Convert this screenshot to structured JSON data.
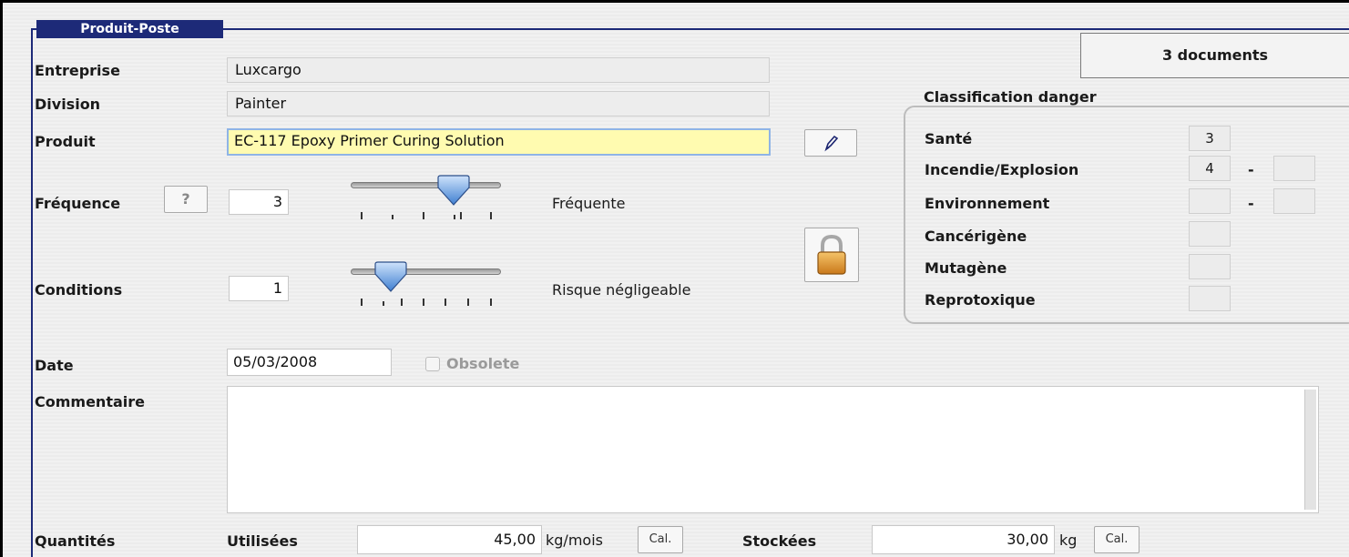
{
  "group": {
    "title": "Produit-Poste"
  },
  "documents_button": "3 documents",
  "fields": {
    "entreprise": {
      "label": "Entreprise",
      "value": "Luxcargo"
    },
    "division": {
      "label": "Division",
      "value": "Painter"
    },
    "produit": {
      "label": "Produit",
      "value": "EC-117 Epoxy Primer Curing Solution"
    },
    "frequence": {
      "label": "Fréquence",
      "help_button": "?",
      "value": "3",
      "slider_level": 3,
      "slider_max": 5,
      "description": "Fréquente"
    },
    "conditions": {
      "label": "Conditions",
      "value": "1",
      "slider_level": 1,
      "slider_max": 7,
      "description": "Risque négligeable"
    },
    "date": {
      "label": "Date",
      "value": "05/03/2008"
    },
    "obsolete": {
      "label": "Obsolete",
      "checked": false
    },
    "commentaire": {
      "label": "Commentaire",
      "value": ""
    },
    "quantites": {
      "label": "Quantités",
      "utilisees_label": "Utilisées",
      "utilisees_value": "45,00",
      "utilisees_unit": "kg/mois",
      "stockees_label": "Stockées",
      "stockees_value": "30,00",
      "stockees_unit": "kg",
      "cal_label": "Cal."
    }
  },
  "classification": {
    "title": "Classification danger",
    "rows": [
      {
        "label": "Santé",
        "value": "3"
      },
      {
        "label": "Incendie/Explosion",
        "value": "4",
        "dash": "-",
        "value2": ""
      },
      {
        "label": "Environnement",
        "value": "",
        "dash": "-",
        "value2": ""
      },
      {
        "label": "Cancérigène",
        "value": ""
      },
      {
        "label": "Mutagène",
        "value": ""
      },
      {
        "label": "Reprotoxique",
        "value": ""
      }
    ]
  },
  "icons": {
    "edit": "pencil-icon",
    "lock": "lock-icon",
    "help": "question-icon"
  }
}
